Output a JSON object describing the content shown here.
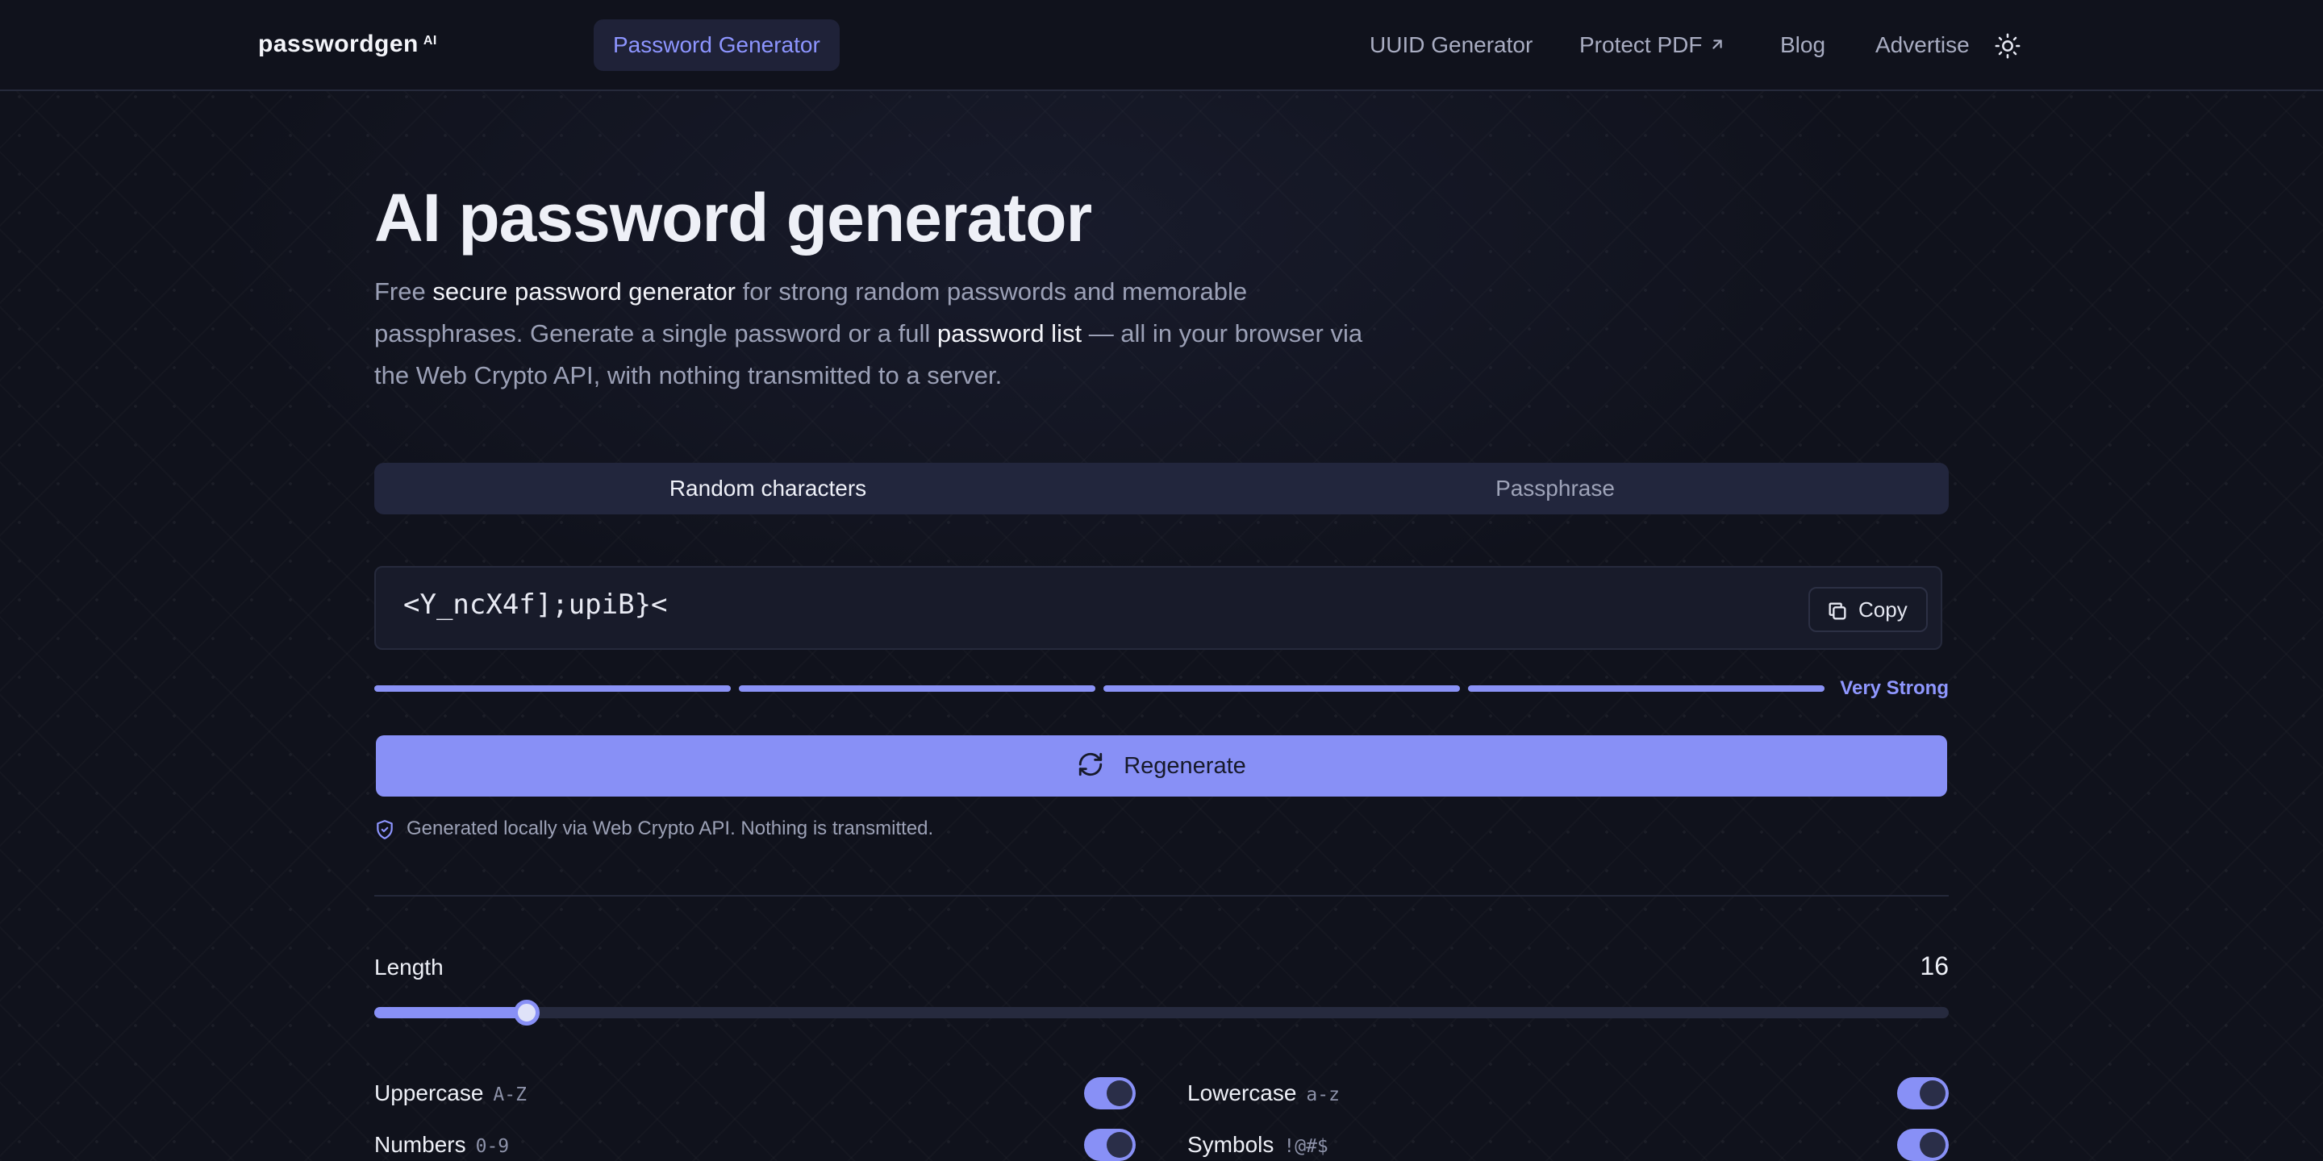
{
  "nav": {
    "logo": {
      "text": "passwordgen",
      "superscript": "AI"
    },
    "items": [
      {
        "label": "Password Generator",
        "active": true
      },
      {
        "label": "UUID Generator"
      },
      {
        "label": "Protect PDF",
        "icon": "external-arrow-icon"
      },
      {
        "label": "Blog"
      },
      {
        "label": "Advertise"
      }
    ],
    "theme_toggle_icon": "sun-icon"
  },
  "hero": {
    "title": "AI password generator",
    "intro": {
      "p1": "Free ",
      "s1": "secure password generator",
      "p2": " for strong random passwords and memorable passphrases. Generate a single password or a full ",
      "s2": "password list",
      "p3": " — all in your browser via the Web Crypto API, with nothing transmitted to a server."
    }
  },
  "mode_tabs": [
    {
      "label": "Random characters",
      "selected": true
    },
    {
      "label": "Passphrase",
      "selected": false
    }
  ],
  "generator": {
    "password": "<Y_ncX4f];upiB}<",
    "copy_label": "Copy",
    "strength": {
      "label": "Very Strong",
      "filled_segments": 4,
      "total_segments": 4
    },
    "regenerate_label": "Regenerate",
    "note": "Generated locally via Web Crypto API. Nothing is transmitted."
  },
  "settings": {
    "length": {
      "label": "Length",
      "value": "16",
      "min": 4,
      "max": 128,
      "current": 16
    },
    "options": [
      {
        "label": "Uppercase",
        "hint": "A-Z",
        "enabled": true
      },
      {
        "label": "Lowercase",
        "hint": "a-z",
        "enabled": true
      },
      {
        "label": "Numbers",
        "hint": "0-9",
        "enabled": true
      },
      {
        "label": "Symbols",
        "hint": "!@#$",
        "enabled": true
      }
    ]
  },
  "colors": {
    "background": "#10121c",
    "accent": "#8890f6",
    "accent_text": "#8d95ff",
    "text": "#eef0f7",
    "muted": "#9ba0b6"
  }
}
